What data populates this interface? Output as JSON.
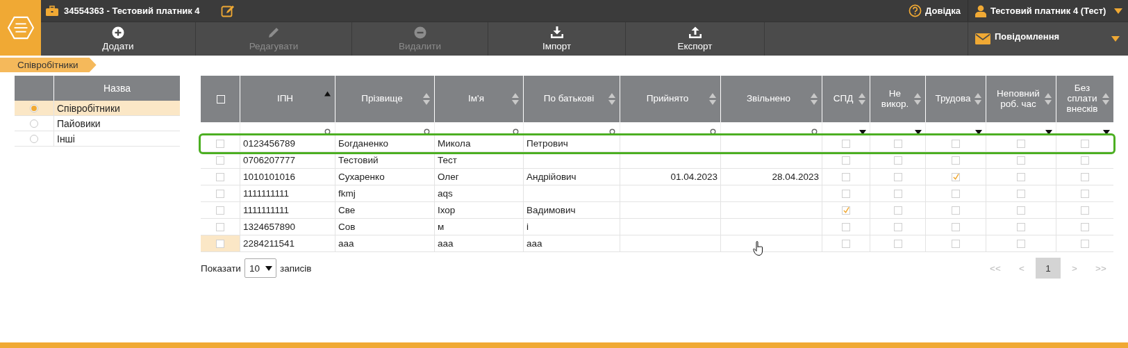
{
  "topbar": {
    "title": "34554363 - Тестовий платник 4",
    "help": "Довідка",
    "user": "Тестовий платник 4 (Тест)"
  },
  "toolbar": {
    "buttons": [
      {
        "kind": "add",
        "label": "Додати",
        "disabled": false
      },
      {
        "kind": "edit",
        "label": "Редагувати",
        "disabled": true
      },
      {
        "kind": "delete",
        "label": "Видалити",
        "disabled": true
      },
      {
        "kind": "import",
        "label": "Імпорт",
        "disabled": false
      },
      {
        "kind": "export",
        "label": "Експорт",
        "disabled": false
      }
    ],
    "messages": "Повідомлення"
  },
  "breadcrumb": "Співробітники",
  "sidebar": {
    "header": "Назва",
    "items": [
      {
        "label": "Співробітники",
        "selected": true
      },
      {
        "label": "Пайовики",
        "selected": false
      },
      {
        "label": "Інші",
        "selected": false
      }
    ]
  },
  "table": {
    "select_all": {
      "checked": false
    },
    "columns": [
      {
        "kind": "text",
        "label": "ІПН",
        "sorted": true
      },
      {
        "kind": "text",
        "label": "Прізвище",
        "sorted": false
      },
      {
        "kind": "text",
        "label": "Ім'я",
        "sorted": false
      },
      {
        "kind": "text",
        "label": "По батькові",
        "sorted": false
      },
      {
        "kind": "date",
        "label": "Прийнято",
        "sorted": false
      },
      {
        "kind": "date",
        "label": "Звільнено",
        "sorted": false
      },
      {
        "kind": "flag",
        "label": "СПД",
        "sorted": false
      },
      {
        "kind": "flag",
        "label": "Не викор.",
        "sorted": false
      },
      {
        "kind": "flag",
        "label": "Трудова",
        "sorted": false
      },
      {
        "kind": "flag",
        "label": "Неповний роб. час",
        "sorted": false
      },
      {
        "kind": "flag",
        "label": "Без сплати внесків",
        "sorted": false
      }
    ],
    "rows": [
      {
        "selected": false,
        "outlined": true,
        "hovered": false,
        "cells": [
          "0123456789",
          "Богданенко",
          "Микола",
          "Петрович",
          null,
          null
        ],
        "flags": [
          false,
          false,
          false,
          false,
          false
        ]
      },
      {
        "selected": false,
        "outlined": false,
        "hovered": false,
        "cells": [
          "0706207777",
          "Тестовий",
          "Тест",
          null,
          null,
          null
        ],
        "flags": [
          false,
          false,
          false,
          false,
          false
        ]
      },
      {
        "selected": false,
        "outlined": false,
        "hovered": false,
        "cells": [
          "1010101016",
          "Сухаренко",
          "Олег",
          "Андрійович",
          "01.04.2023",
          "28.04.2023"
        ],
        "flags": [
          false,
          false,
          true,
          false,
          false
        ]
      },
      {
        "selected": false,
        "outlined": false,
        "hovered": false,
        "cells": [
          "1111111111",
          "fkmj",
          "aqs",
          null,
          null,
          null
        ],
        "flags": [
          false,
          false,
          false,
          false,
          false
        ]
      },
      {
        "selected": false,
        "outlined": false,
        "hovered": false,
        "cells": [
          "1111111111",
          "Све",
          "Іхор",
          "Вадимович",
          null,
          null
        ],
        "flags": [
          true,
          false,
          false,
          false,
          false
        ]
      },
      {
        "selected": false,
        "outlined": false,
        "hovered": false,
        "cells": [
          "1324657890",
          "Сов",
          "м",
          "і",
          null,
          null
        ],
        "flags": [
          false,
          false,
          false,
          false,
          false
        ]
      },
      {
        "selected": false,
        "outlined": false,
        "hovered": true,
        "cells": [
          "2284211541",
          "aaa",
          "aaa",
          "aaa",
          null,
          null
        ],
        "flags": [
          false,
          false,
          false,
          false,
          false
        ]
      }
    ]
  },
  "footer": {
    "show_label": "Показати",
    "page_size": "10",
    "records_label": "записів",
    "pages": [
      {
        "label": "<<",
        "selected": false,
        "disabled": true
      },
      {
        "label": "<",
        "selected": false,
        "disabled": true
      },
      {
        "label": "1",
        "selected": true,
        "disabled": false
      },
      {
        "label": ">",
        "selected": false,
        "disabled": true
      },
      {
        "label": ">>",
        "selected": false,
        "disabled": true
      }
    ]
  }
}
